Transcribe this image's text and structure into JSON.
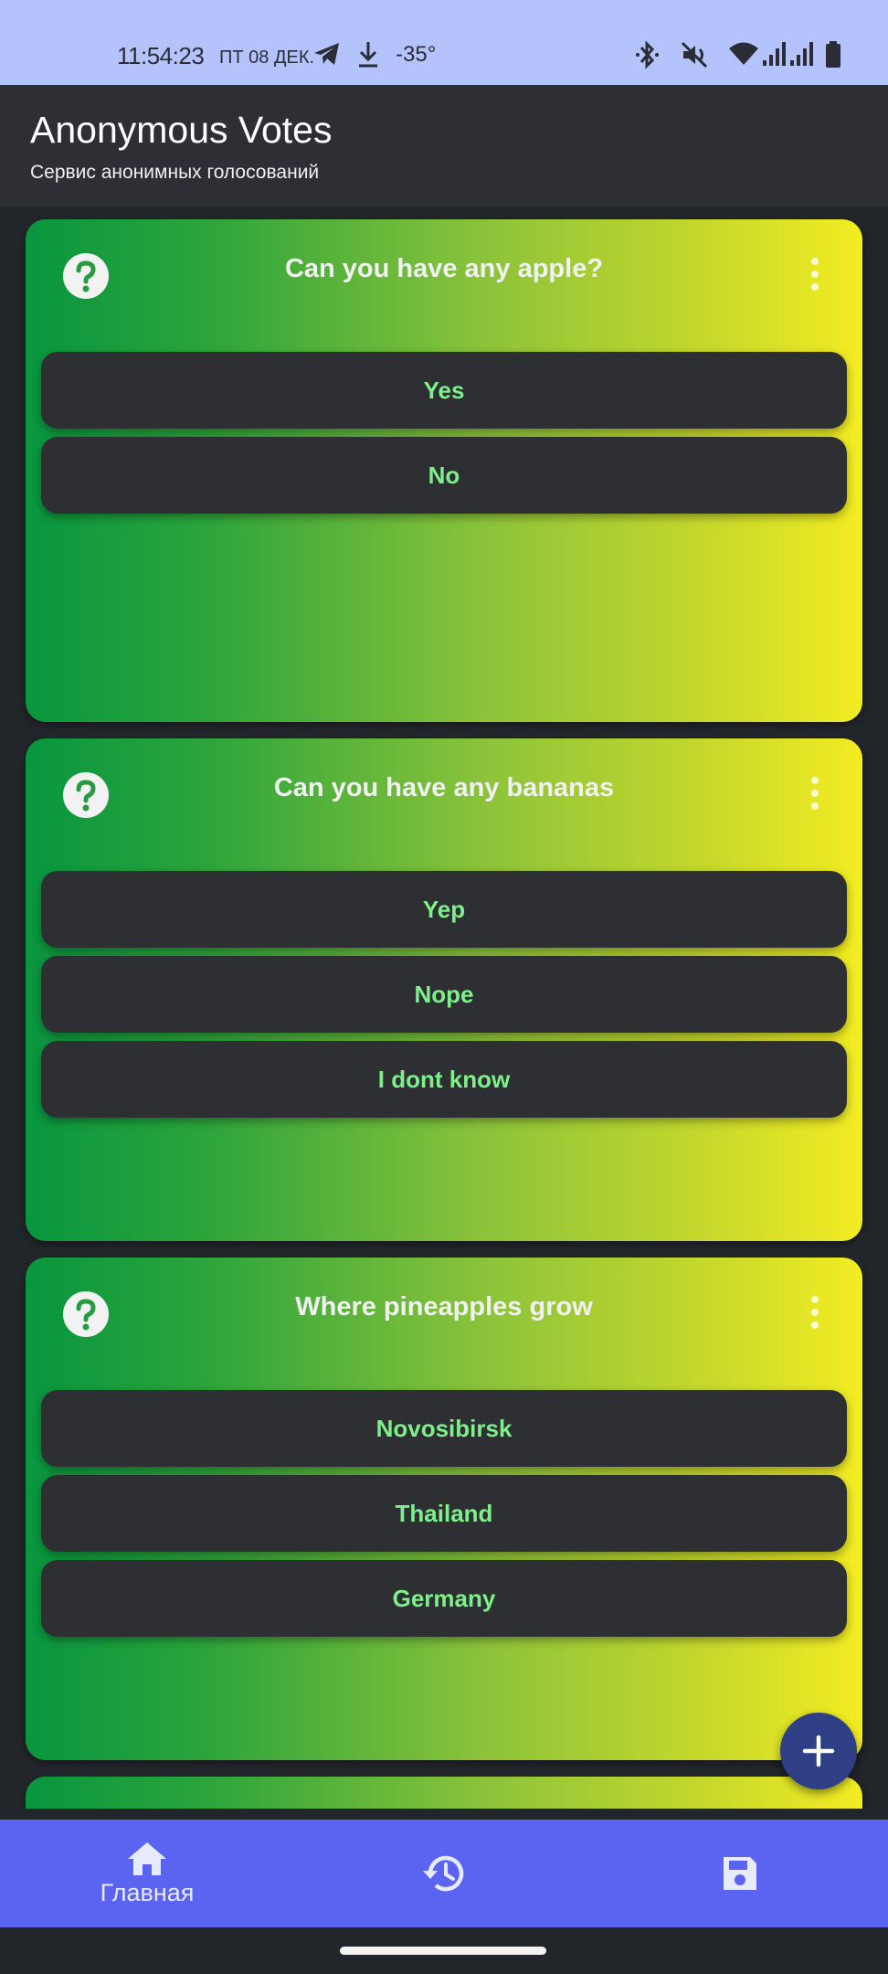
{
  "status_bar": {
    "time": "11:54:23",
    "date": "ПТ 08 ДЕК.",
    "temperature": "-35°",
    "icons": [
      "telegram-icon",
      "download-icon",
      "bluetooth-icon",
      "mute-icon",
      "wifi-icon",
      "signal-icon",
      "signal-icon",
      "battery-icon"
    ]
  },
  "app_bar": {
    "title": "Anonymous Votes",
    "subtitle": "Сервис анонимных голосований"
  },
  "polls": [
    {
      "question": "Can you have any apple?",
      "options": [
        "Yes",
        "No"
      ]
    },
    {
      "question": "Can you have any bananas",
      "options": [
        "Yep",
        "Nope",
        "I dont know"
      ]
    },
    {
      "question": "Where pineapples grow",
      "options": [
        "Novosibirsk",
        "Thailand",
        "Germany"
      ]
    }
  ],
  "bottom_nav": {
    "items": [
      {
        "label": "Главная",
        "icon": "home-icon",
        "active": true
      },
      {
        "label": "",
        "icon": "history-icon",
        "active": false
      },
      {
        "label": "",
        "icon": "save-icon",
        "active": false
      }
    ]
  },
  "colors": {
    "status_bar": "#b4c3fc",
    "app_bar": "#2d2f34",
    "background": "#222529",
    "card_gradient_start": "#08963f",
    "card_gradient_end": "#f3ec22",
    "option_bg": "#2d2f33",
    "option_text": "#7ef08a",
    "fab": "#2f3f86",
    "bottom_nav": "#5a64f0"
  }
}
